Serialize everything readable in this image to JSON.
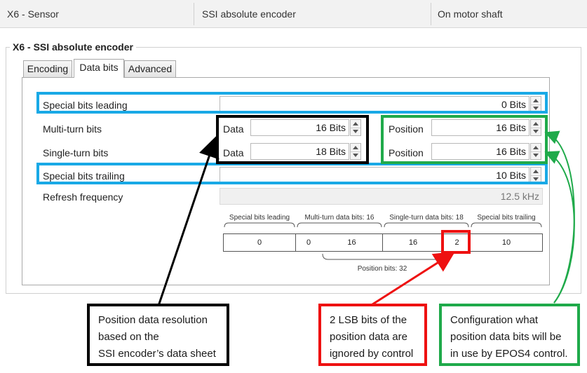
{
  "header": {
    "sensor": "X6 - Sensor",
    "encoder": "SSI absolute encoder",
    "location": "On motor shaft"
  },
  "group": {
    "title": "X6 - SSI absolute encoder"
  },
  "tabs": [
    {
      "label": "Encoding",
      "active": false
    },
    {
      "label": "Data bits",
      "active": true
    },
    {
      "label": "Advanced",
      "active": false
    }
  ],
  "form": {
    "special_leading": {
      "label": "Special bits leading",
      "value": "0 Bits"
    },
    "multi_turn": {
      "label": "Multi-turn bits",
      "data_label": "Data",
      "data_value": "16 Bits",
      "pos_label": "Position",
      "pos_value": "16 Bits"
    },
    "single_turn": {
      "label": "Single-turn bits",
      "data_label": "Data",
      "data_value": "18 Bits",
      "pos_label": "Position",
      "pos_value": "16 Bits"
    },
    "special_trailing": {
      "label": "Special bits trailing",
      "value": "10 Bits"
    },
    "refresh": {
      "label": "Refresh frequency",
      "value": "12.5 kHz"
    }
  },
  "bits": {
    "headers": {
      "leading": "Special bits leading",
      "multi": "Multi-turn data bits: 16",
      "single": "Single-turn data bits: 18",
      "trailing": "Special bits trailing"
    },
    "cells": {
      "leading": "0",
      "multi_ignored": "0",
      "multi_used": "16",
      "single_used": "16",
      "single_ignored": "2",
      "trailing": "10"
    },
    "position_label": "Position bits: 32"
  },
  "callouts": {
    "black": [
      "Position data resolution",
      "based on the",
      "SSI encoder’s data sheet"
    ],
    "red": [
      "2 LSB bits of the",
      "position data are",
      "ignored by control"
    ],
    "green": [
      "Configuration what",
      "position data bits will be",
      "in use by EPOS4 control."
    ]
  },
  "colors": {
    "blue": "#19a9e6",
    "black": "#000000",
    "green": "#1faa4a",
    "red": "#ee1111"
  }
}
